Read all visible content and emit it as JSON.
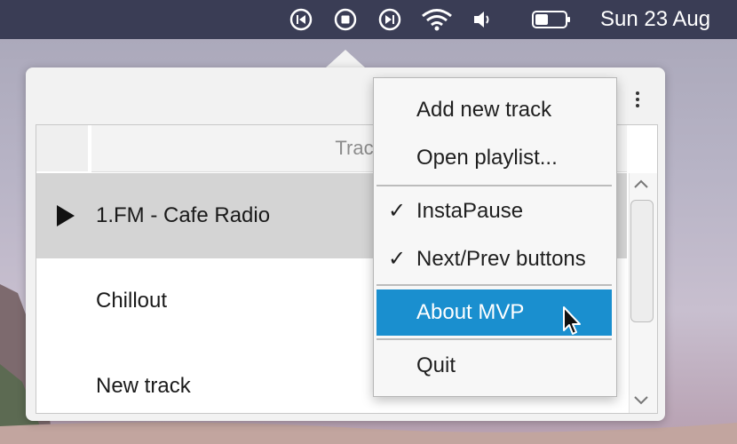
{
  "menubar": {
    "clock": "Sun 23 Aug",
    "icons": [
      "previous-track-icon",
      "stop-icon",
      "next-track-icon",
      "wifi-icon",
      "volume-icon",
      "battery-icon"
    ]
  },
  "player": {
    "column_header": "Track",
    "tracks": [
      {
        "label": "1.FM - Cafe Radio",
        "playing": true,
        "selected": true
      },
      {
        "label": "Chillout",
        "playing": false,
        "selected": false
      },
      {
        "label": "New track",
        "playing": false,
        "selected": false
      }
    ]
  },
  "menu": {
    "add_track": "Add new track",
    "open_playlist": "Open playlist...",
    "instapause": "InstaPause",
    "nextprev": "Next/Prev buttons",
    "about": "About MVP",
    "quit": "Quit",
    "check_glyph": "✓"
  },
  "colors": {
    "menubar": "#3a3d55",
    "highlight": "#1a8fcf",
    "selected_row": "#d4d4d4"
  }
}
